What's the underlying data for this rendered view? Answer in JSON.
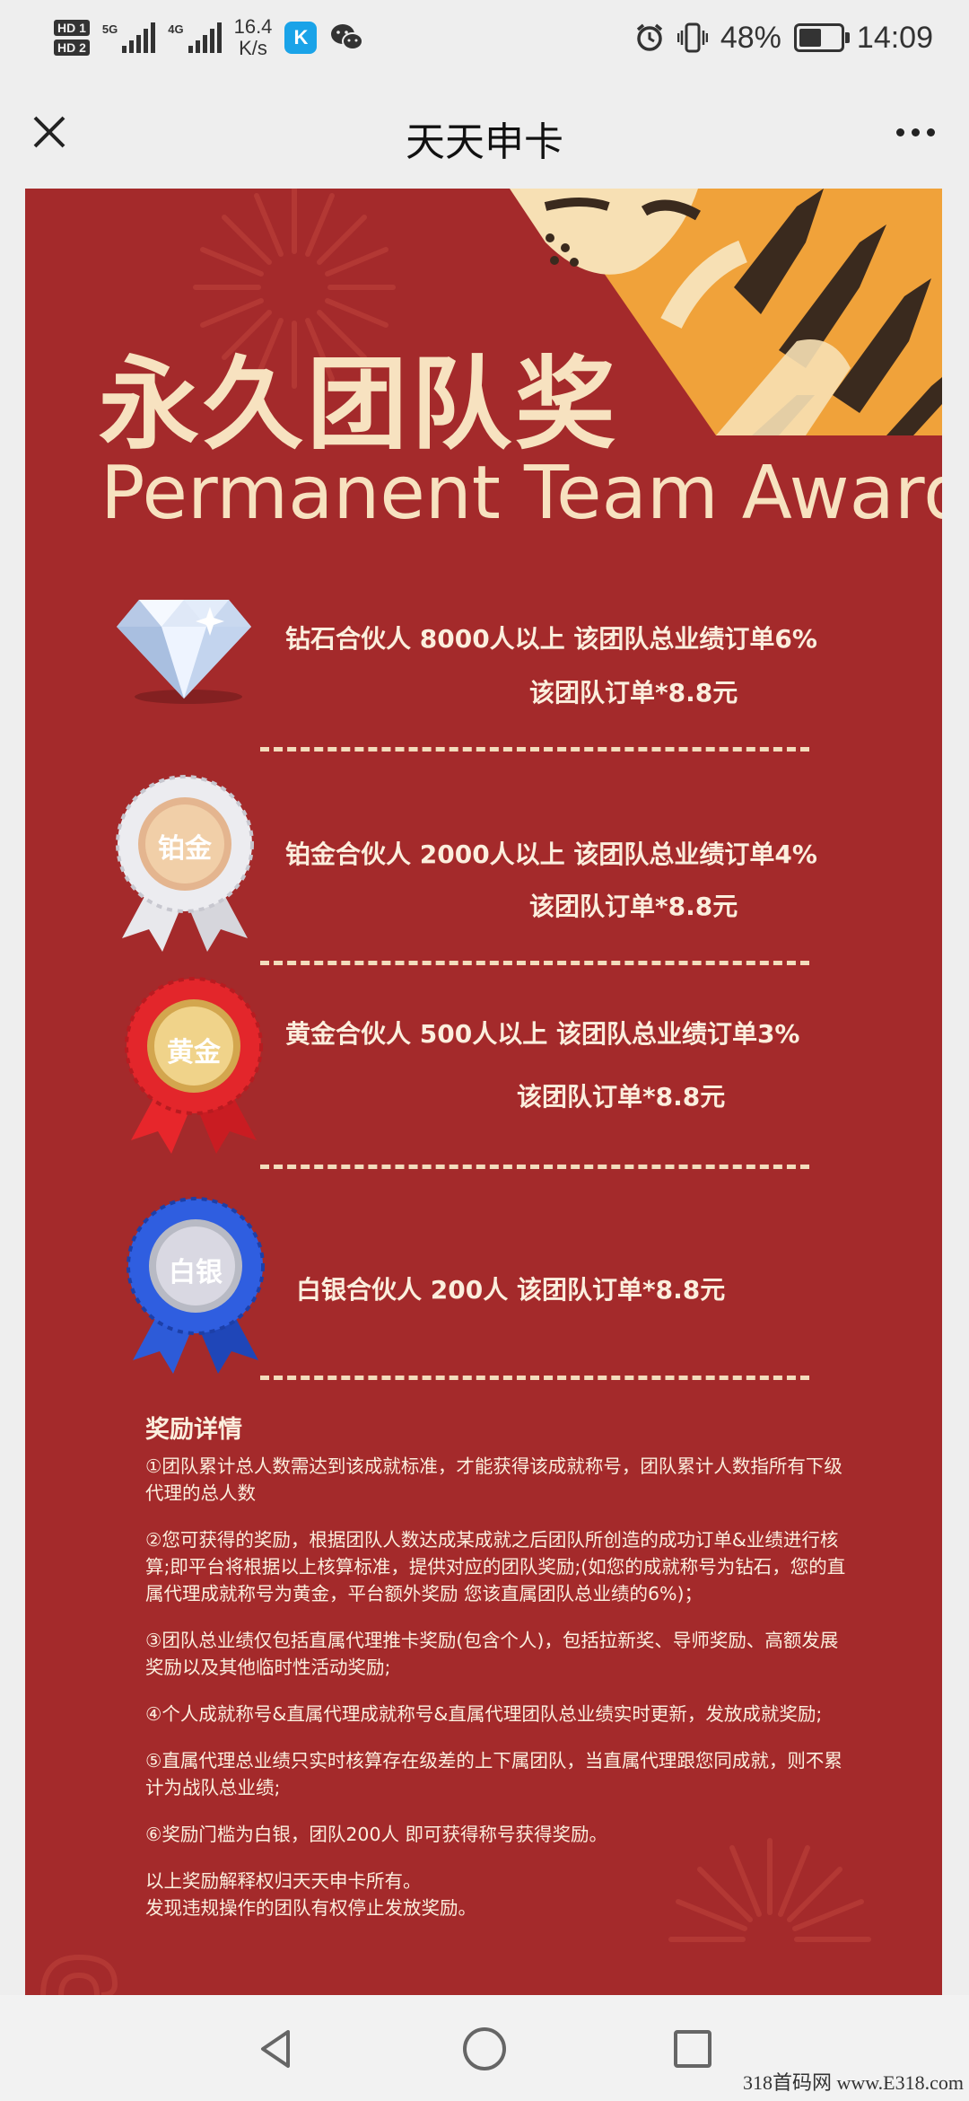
{
  "status_bar": {
    "left": {
      "hd1": "HD 1",
      "hd2": "HD 2",
      "net1": "5G",
      "net2": "4G",
      "speed_value": "16.4",
      "speed_unit": "K/s"
    },
    "right": {
      "battery_text": "48%",
      "battery_level": 0.48,
      "time": "14:09"
    },
    "icons": [
      "alarm-icon",
      "vibrate-icon",
      "battery-icon",
      "k-app-icon",
      "wechat-icon"
    ]
  },
  "header": {
    "title": "天天申卡"
  },
  "poster": {
    "headline_cn": "永久团队奖",
    "headline_en": "Permanent Team Award",
    "tiers": [
      {
        "icon": "diamond-icon",
        "line1": "钻石合伙人 8000人以上 该团队总业绩订单6%",
        "line2": "该团队订单*8.8元"
      },
      {
        "icon": "platinum-medal-icon",
        "medal": "铂金",
        "line1": "铂金合伙人 2000人以上 该团队总业绩订单4%",
        "line2": "该团队订单*8.8元"
      },
      {
        "icon": "gold-medal-icon",
        "medal": "黄金",
        "line1": "黄金合伙人 500人以上 该团队总业绩订单3%",
        "line2": "该团队订单*8.8元"
      },
      {
        "icon": "silver-medal-icon",
        "medal": "白银",
        "line1": "白银合伙人 200人  该团队订单*8.8元"
      }
    ],
    "details_title": "奖励详情",
    "details": [
      "①团队累计总人数需达到该成就标准，才能获得该成就称号，团队累计人数指所有下级代理的总人数",
      "②您可获得的奖励，根据团队人数达成某成就之后团队所创造的成功订单&业绩进行核算;即平台将根据以上核算标准，提供对应的团队奖励;(如您的成就称号为钻石，您的直属代理成就称号为黄金，平台额外奖励 您该直属团队总业绩的6%)；",
      "③团队总业绩仅包括直属代理推卡奖励(包含个人)，包括拉新奖、导师奖励、高额发展奖励以及其他临时性活动奖励;",
      "④个人成就称号&直属代理成就称号&直属代理团队总业绩实时更新，发放成就奖励;",
      "⑤直属代理总业绩只实时核算存在级差的上下属团队，当直属代理跟您同成就，则不累计为战队总业绩;",
      "⑥奖励门槛为白银，团队200人 即可获得称号获得奖励。",
      "以上奖励解释权归天天申卡所有。\n发现违规操作的团队有权停止发放奖励。"
    ]
  },
  "nav": {
    "back": "back-icon",
    "home": "home-icon",
    "recents": "recents-icon"
  },
  "watermark": "318首码网 www.E318.com"
}
